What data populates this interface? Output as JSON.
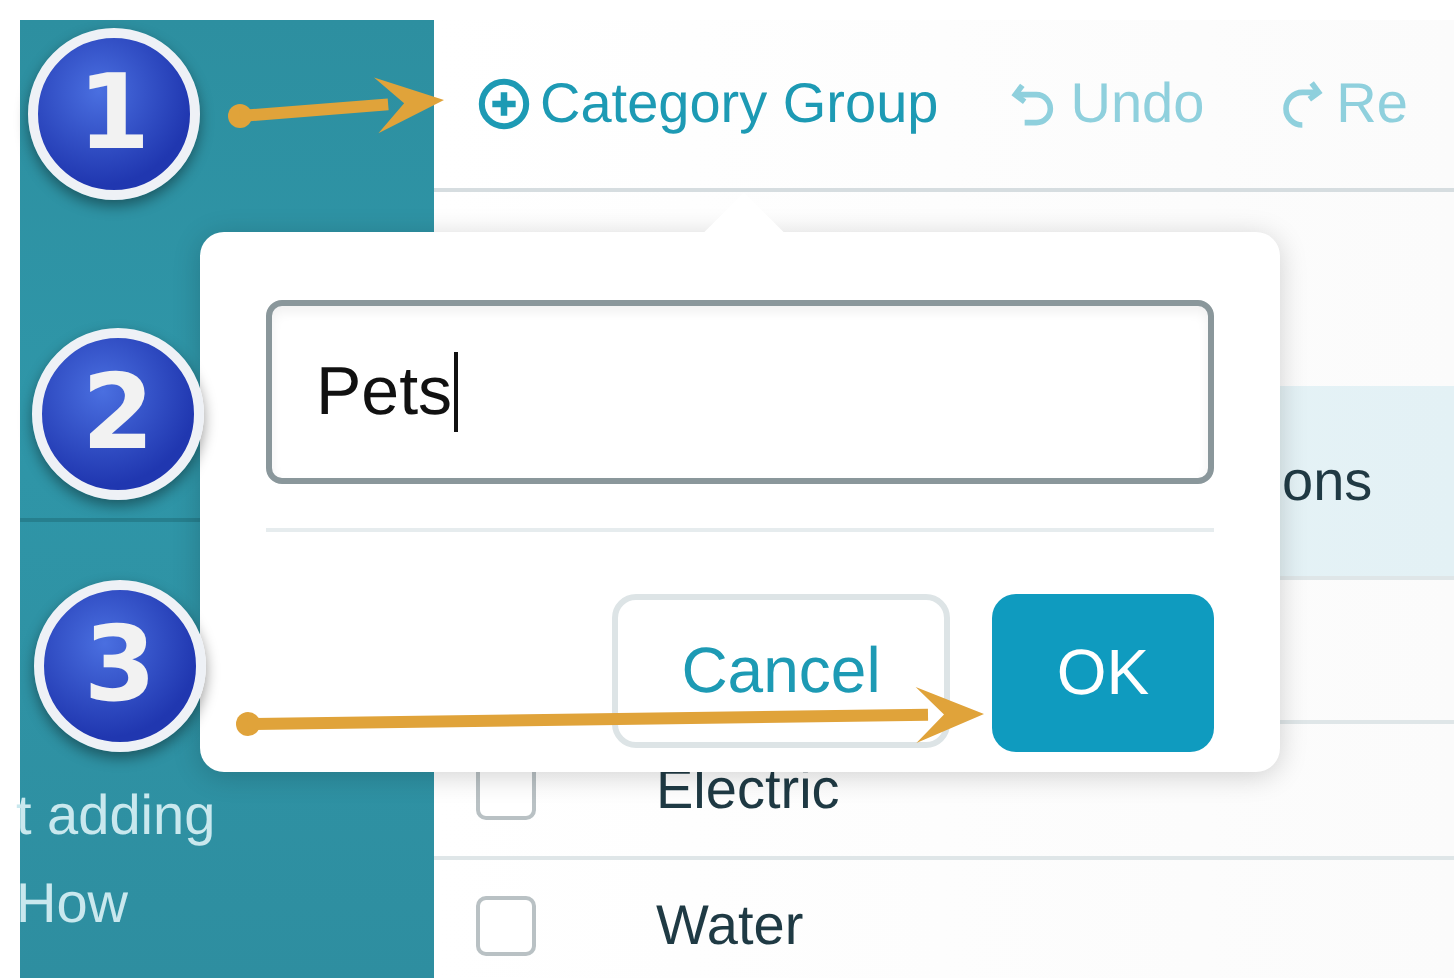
{
  "sidebar": {
    "lines": [
      "t adding",
      "How"
    ]
  },
  "toolbar": {
    "items": [
      {
        "kind": "add",
        "label": "Category Group",
        "disabled": false
      },
      {
        "kind": "undo",
        "label": "Undo",
        "disabled": true
      },
      {
        "kind": "redo",
        "label": "Re",
        "disabled": true
      }
    ]
  },
  "table": {
    "header": "ons",
    "rows": [
      {
        "label": "Electric",
        "checked": false
      },
      {
        "label": "Water",
        "checked": false
      }
    ]
  },
  "dialog": {
    "input": {
      "value": "Pets"
    },
    "buttons": [
      {
        "kind": "secondary",
        "label": "Cancel"
      },
      {
        "kind": "primary",
        "label": "OK"
      }
    ]
  },
  "annotations": [
    {
      "number": "1"
    },
    {
      "number": "2"
    },
    {
      "number": "3"
    }
  ]
}
